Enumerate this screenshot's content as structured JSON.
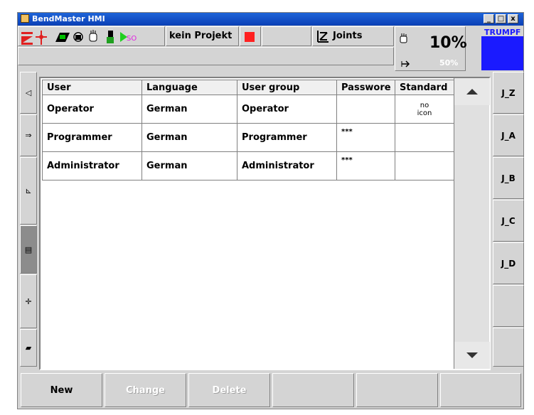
{
  "window": {
    "title": "BendMaster HMI",
    "minimize": "_",
    "maximize": "□",
    "close": "x"
  },
  "toolbar": {
    "project": "kein Projekt",
    "mode": "Joints",
    "speed": "10%",
    "speed_secondary": "50%",
    "brand": "TRUMPF"
  },
  "table": {
    "headers": [
      "User",
      "Language",
      "User group",
      "Passwore",
      "Standard"
    ],
    "rows": [
      {
        "user": "Operator",
        "language": "German",
        "group": "Operator",
        "password": "",
        "standard": "no icon"
      },
      {
        "user": "Programmer",
        "language": "German",
        "group": "Programmer",
        "password": "***",
        "standard": ""
      },
      {
        "user": "Administrator",
        "language": "German",
        "group": "Administrator",
        "password": "***",
        "standard": ""
      }
    ]
  },
  "joints": [
    "J_Z",
    "J_A",
    "J_B",
    "J_C",
    "J_D"
  ],
  "bottom": {
    "new": "New",
    "change": "Change",
    "delete": "Delete"
  },
  "colors": {
    "brand_blue": "#1a1aff",
    "stop_red": "#ff2020",
    "title_blue": "#0a3fb5"
  }
}
